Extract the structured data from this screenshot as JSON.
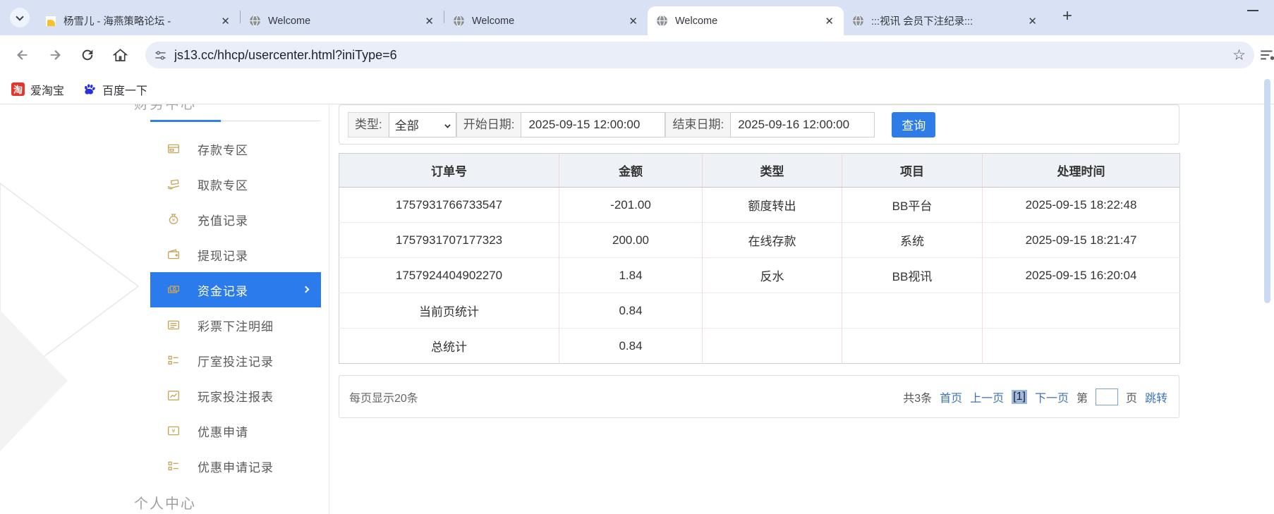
{
  "browser": {
    "tabs": [
      {
        "title": "杨雪儿 - 海燕策略论坛 -",
        "favicon": "forum-doc",
        "active": false
      },
      {
        "title": "Welcome",
        "favicon": "globe",
        "active": false
      },
      {
        "title": "Welcome",
        "favicon": "globe",
        "active": false
      },
      {
        "title": "Welcome",
        "favicon": "globe",
        "active": true
      },
      {
        "title": ":::视讯 会员下注纪录:::",
        "favicon": "globe",
        "active": false
      }
    ],
    "url": "js13.cc/hhcp/usercenter.html?iniType=6",
    "bookmarks": [
      {
        "label": "爱淘宝",
        "icon": "taobao",
        "icon_glyph": "淘"
      },
      {
        "label": "百度一下",
        "icon": "baidu-paw"
      }
    ]
  },
  "sidebar": {
    "section_title": "财务中心",
    "items": [
      {
        "label": "存款专区",
        "icon": "deposit-card-icon",
        "active": false
      },
      {
        "label": "取款专区",
        "icon": "withdraw-hand-icon",
        "active": false
      },
      {
        "label": "充值记录",
        "icon": "money-bag-icon",
        "active": false
      },
      {
        "label": "提现记录",
        "icon": "wallet-icon",
        "active": false
      },
      {
        "label": "资金记录",
        "icon": "banknotes-icon",
        "active": true
      },
      {
        "label": "彩票下注明细",
        "icon": "list-icon",
        "active": false
      },
      {
        "label": "厅室投注记录",
        "icon": "grid-list-icon",
        "active": false
      },
      {
        "label": "玩家投注报表",
        "icon": "chart-icon",
        "active": false
      },
      {
        "label": "优惠申请",
        "icon": "coupon-icon",
        "active": false
      },
      {
        "label": "优惠申请记录",
        "icon": "grid-list-icon",
        "active": false
      }
    ],
    "footer_title": "个人中心"
  },
  "filters": {
    "type_label": "类型:",
    "type_value": "全部",
    "start_label": "开始日期:",
    "start_value": "2025-09-15 12:00:00",
    "end_label": "结束日期:",
    "end_value": "2025-09-16 12:00:00",
    "search_button": "查询"
  },
  "table": {
    "columns": [
      "订单号",
      "金额",
      "类型",
      "项目",
      "处理时间"
    ],
    "rows": [
      [
        "1757931766733547",
        "-201.00",
        "额度转出",
        "BB平台",
        "2025-09-15 18:22:48"
      ],
      [
        "1757931707177323",
        "200.00",
        "在线存款",
        "系统",
        "2025-09-15 18:21:47"
      ],
      [
        "1757924404902270",
        "1.84",
        "反水",
        "BB视讯",
        "2025-09-15 16:20:04"
      ],
      [
        "当前页统计",
        "0.84",
        "",
        "",
        ""
      ],
      [
        "总统计",
        "0.84",
        "",
        "",
        ""
      ]
    ]
  },
  "pagination": {
    "page_size_text": "每页显示20条",
    "total_text": "共3条",
    "first": "首页",
    "prev": "上一页",
    "current": "[1]",
    "next": "下一页",
    "jump_prefix": "第",
    "jump_suffix": "页",
    "jump_button": "跳转"
  },
  "colors": {
    "accent_blue": "#2b7bed",
    "gold_icon": "#c9a55a",
    "link_blue": "#3d74b8",
    "tabstrip_bg": "#d9e2f5"
  }
}
